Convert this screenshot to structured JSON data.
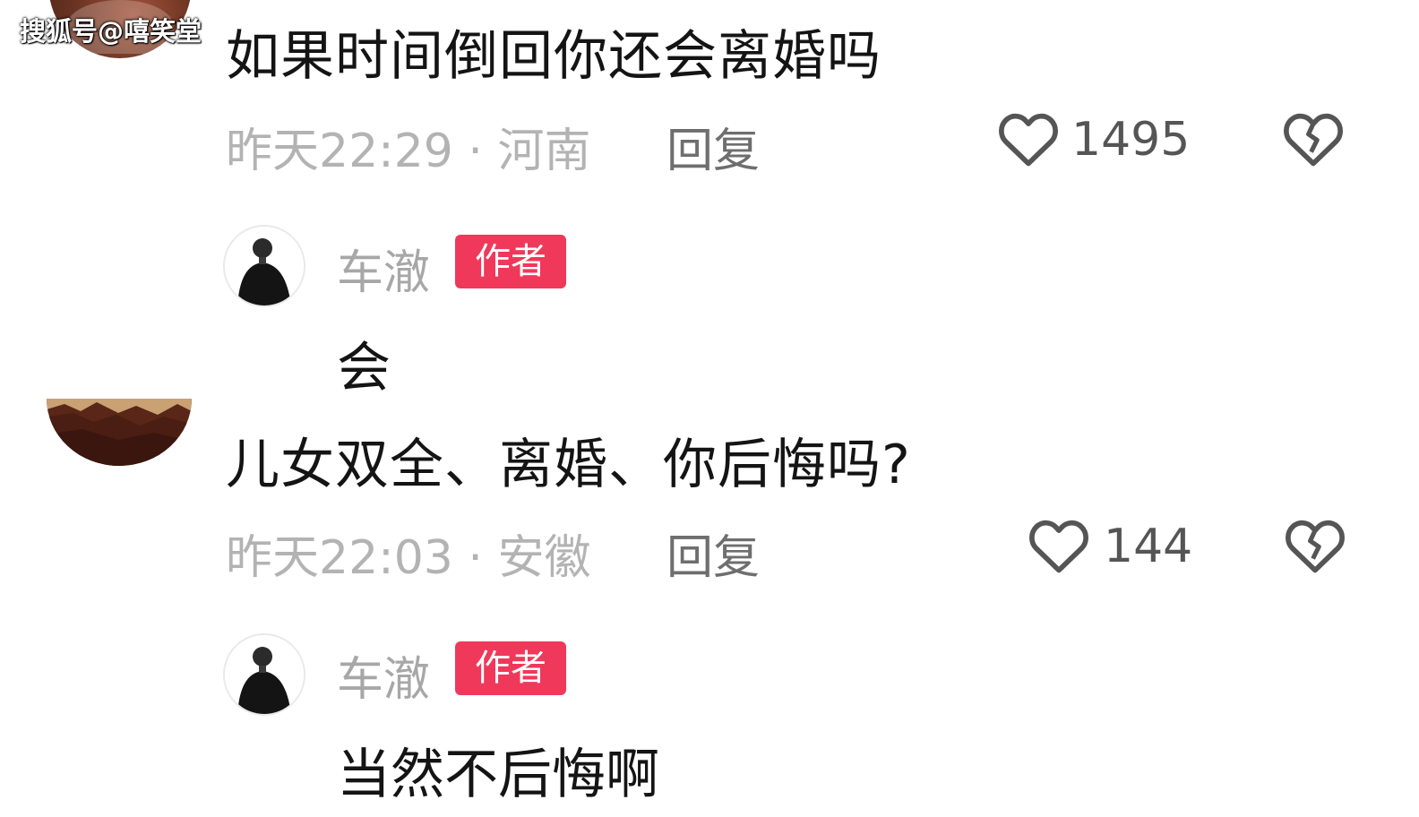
{
  "watermark": "搜狐号@嘻笑堂",
  "comments": [
    {
      "text": "如果时间倒回你还会离婚吗",
      "time_location": "昨天22:29 · 河南",
      "reply_label": "回复",
      "likes": "1495",
      "reply": {
        "author": "车澈",
        "badge": "作者",
        "text": "会"
      }
    },
    {
      "text": "儿女双全、离婚、你后悔吗?",
      "time_location": "昨天22:03 · 安徽",
      "reply_label": "回复",
      "likes": "144",
      "reply": {
        "author": "车澈",
        "badge": "作者",
        "text": "当然不后悔啊"
      }
    }
  ],
  "icons": {
    "like": "heart-outline-icon",
    "dislike": "broken-heart-icon"
  },
  "colors": {
    "badge": "#f0385a",
    "meta_text": "#b3b3b3",
    "main_text": "#141414"
  }
}
